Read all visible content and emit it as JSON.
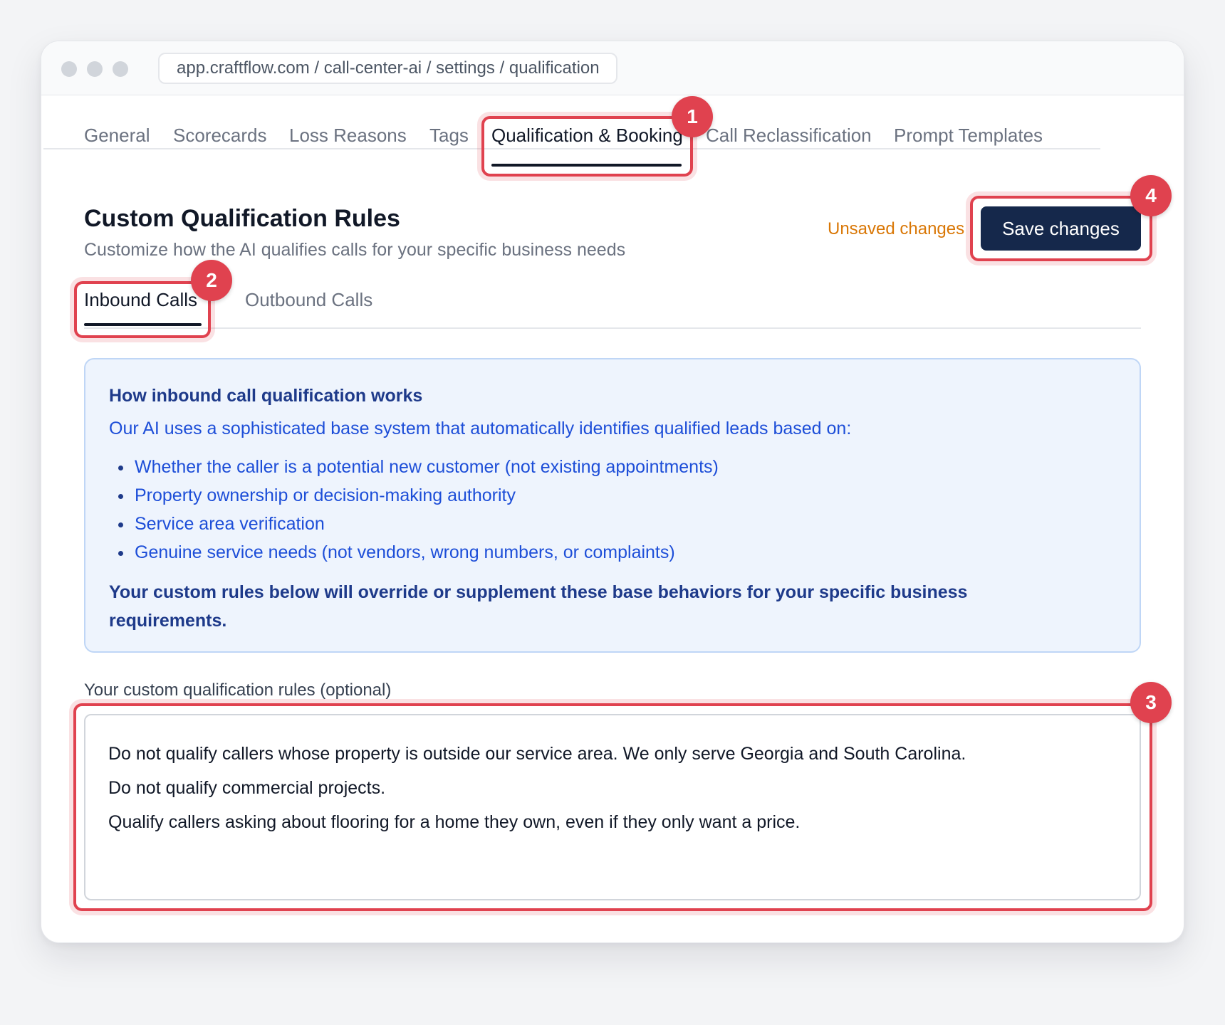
{
  "browser": {
    "url": "app.craftflow.com / call-center-ai / settings / qualification"
  },
  "top_nav": {
    "tabs": [
      {
        "label": "General",
        "active": false
      },
      {
        "label": "Scorecards",
        "active": false
      },
      {
        "label": "Loss Reasons",
        "active": false
      },
      {
        "label": "Tags",
        "active": false
      },
      {
        "label": "Qualification & Booking",
        "active": true
      },
      {
        "label": "Call Reclassification",
        "active": false
      },
      {
        "label": "Prompt Templates",
        "active": false
      }
    ]
  },
  "header": {
    "title": "Custom Qualification Rules",
    "subtitle": "Customize how the AI qualifies calls for your specific business needs",
    "unsaved_label": "Unsaved changes",
    "save_label": "Save changes"
  },
  "sub_nav": {
    "tabs": [
      {
        "label": "Inbound Calls",
        "active": true
      },
      {
        "label": "Outbound Calls",
        "active": false
      }
    ]
  },
  "info_box": {
    "title": "How inbound call qualification works",
    "intro": "Our AI uses a sophisticated base system that automatically identifies qualified leads based on:",
    "bullets": [
      "Whether the caller is a potential new customer (not existing appointments)",
      "Property ownership or decision-making authority",
      "Service area verification",
      "Genuine service needs (not vendors, wrong numbers, or complaints)"
    ],
    "note": "Your custom rules below will override or supplement these base behaviors for your specific business requirements."
  },
  "rules_field": {
    "label": "Your custom qualification rules (optional)",
    "lines": [
      "Do not qualify callers whose property is outside our service area. We only serve Georgia and South Carolina.",
      "Do not qualify commercial projects.",
      "Qualify callers asking about flooring for a home they own, even if they only want a price."
    ]
  },
  "annotations": {
    "badges": [
      "1",
      "2",
      "3",
      "4"
    ]
  },
  "colors": {
    "accent_primary": "#15284b",
    "highlight": "#e0424f",
    "unsaved": "#d97706",
    "info_bg": "#eef4fd",
    "info_text": "#1d4ed8"
  }
}
